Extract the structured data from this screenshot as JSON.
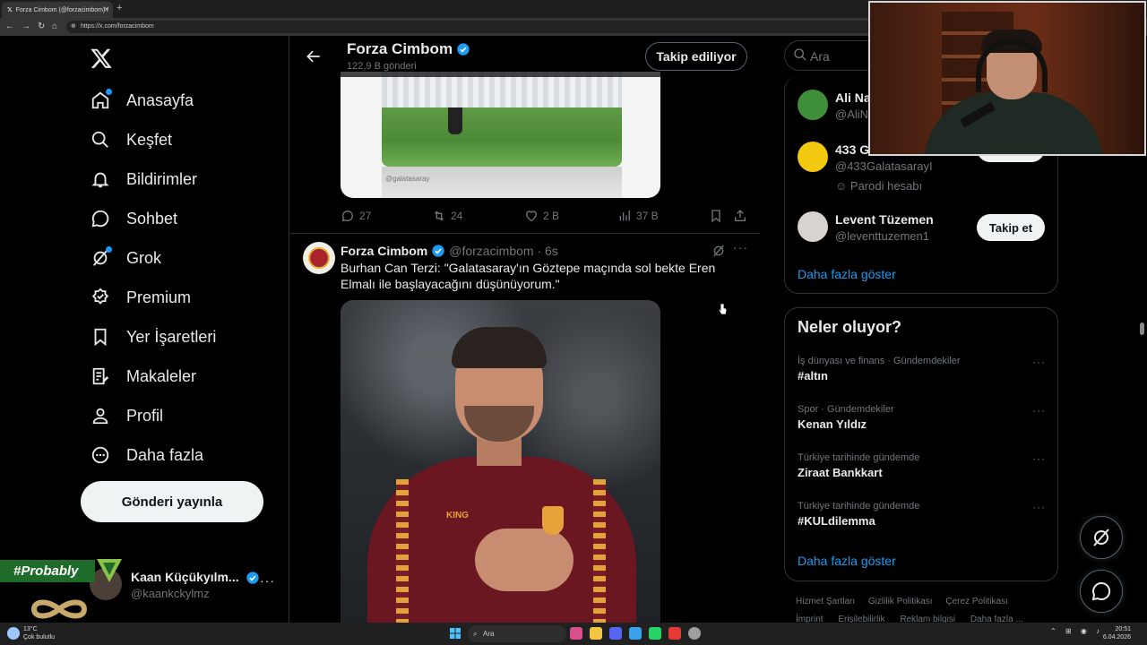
{
  "browser": {
    "tab_title": "Forza Cimbom (@forzacimbom) /",
    "tab_close": "✕",
    "new_tab": "+",
    "url": "https://x.com/forzacimbom"
  },
  "sidebar": {
    "items": [
      {
        "label": "Anasayfa",
        "icon": "home-icon"
      },
      {
        "label": "Keşfet",
        "icon": "search-icon"
      },
      {
        "label": "Bildirimler",
        "icon": "bell-icon"
      },
      {
        "label": "Sohbet",
        "icon": "chat-icon"
      },
      {
        "label": "Grok",
        "icon": "grok-icon"
      },
      {
        "label": "Premium",
        "icon": "premium-icon"
      },
      {
        "label": "Yer İşaretleri",
        "icon": "bookmark-icon"
      },
      {
        "label": "Makaleler",
        "icon": "article-icon"
      },
      {
        "label": "Profil",
        "icon": "person-icon"
      },
      {
        "label": "Daha fazla",
        "icon": "more-circle-icon"
      }
    ],
    "post_button": "Gönderi yayınla",
    "profile": {
      "name": "Kaan Küçükyılm...",
      "handle": "@kaankckylmz",
      "more": "···"
    },
    "overlay_badge": "#Probably"
  },
  "main": {
    "header": {
      "name": "Forza Cimbom",
      "post_count": "122,9 B gönderi",
      "follow_label": "Takip ediliyor"
    },
    "tweet1": {
      "image_tag": "@galatasaray",
      "replies": "27",
      "retweets": "24",
      "likes": "2 B",
      "views": "37 B"
    },
    "tweet2": {
      "name": "Forza Cimbom",
      "handle": "@forzacimbom · 6s",
      "more": "···",
      "text": "Burhan Can Terzi: \"Galatasaray'ın Göztepe maçında sol bekte Eren Elmalı ile başlayacağını düşünüyorum.\"",
      "image_label_brand": "KING"
    }
  },
  "right": {
    "search_placeholder": "Ara",
    "who_to_follow": [
      {
        "name": "Ali Na",
        "handle": "@AliN"
      },
      {
        "name": "433 G",
        "handle": "@433GalatasarayI",
        "parody": "Parodi hesabı",
        "follow": "Takip et"
      },
      {
        "name": "Levent Tüzemen",
        "handle": "@leventtuzemen1",
        "follow": "Takip et"
      }
    ],
    "who_show_more": "Daha fazla göster",
    "trends_title": "Neler oluyor?",
    "trends": [
      {
        "meta": "İş dünyası ve finans · Gündemdekiler",
        "name": "#altın"
      },
      {
        "meta": "Spor · Gündemdekiler",
        "name": "Kenan Yıldız"
      },
      {
        "meta": "Türkiye tarihinde gündemde",
        "name": "Ziraat Bankkart"
      },
      {
        "meta": "Türkiye tarihinde gündemde",
        "name": "#KULdilemma"
      }
    ],
    "trend_more": "···",
    "trends_show_more": "Daha fazla göster",
    "footer": [
      "Hizmet Şartları",
      "Gizlilik Politikası",
      "Çerez Politikası"
    ],
    "footer2": [
      "İmprint",
      "Erişilebilirlik",
      "Reklam bilgisi",
      "Daha fazla ..."
    ]
  },
  "taskbar": {
    "temp": "13°C",
    "weather": "Çok bulutlu",
    "search": "Ara",
    "time": "20:51",
    "date": "6.04.2026"
  },
  "colors": {
    "accent": "#1d9bf0",
    "background": "#000000",
    "border": "#2f3336",
    "muted": "#71767b"
  }
}
